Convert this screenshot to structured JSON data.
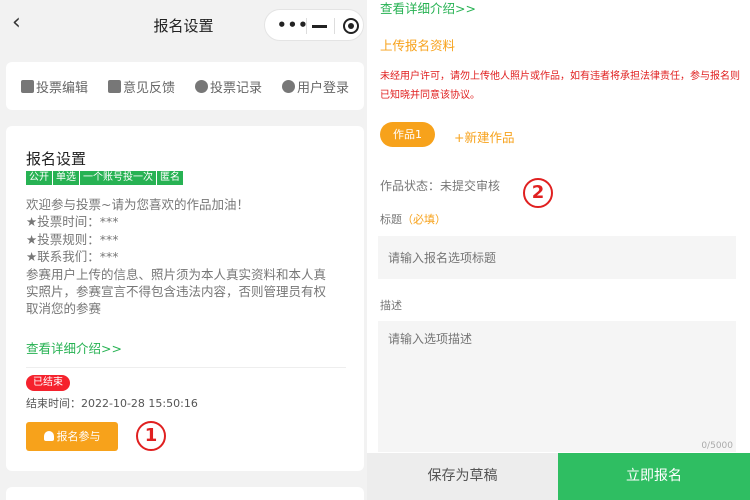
{
  "nav": {
    "back_glyph": "‹",
    "title": "报名设置"
  },
  "tabs": [
    {
      "label": "投票编辑",
      "icon": "pencil-icon"
    },
    {
      "label": "意见反馈",
      "icon": "calendar-icon"
    },
    {
      "label": "投票记录",
      "icon": "user-icon"
    },
    {
      "label": "用户登录",
      "icon": "login-icon"
    }
  ],
  "card": {
    "title": "报名设置",
    "badges": [
      "公开",
      "单选",
      "一个账号投一次",
      "匿名"
    ],
    "desc_lines": [
      "欢迎参与投票~请为您喜欢的作品加油！",
      "★投票时间：***",
      "★投票规则：***",
      "★联系我们：***",
      "参赛用户上传的信息、照片须为本人真实资料和本人真",
      "实照片，参赛宣言不得包含违法内容，否则管理员有权",
      "取消您的参赛"
    ],
    "more_link": "查看详细介绍>>",
    "ended_badge": "已结束",
    "end_time": "结束时间：2022-10-28 15:50:16",
    "join_button": "报名参与"
  },
  "markers": {
    "one": "1",
    "two": "2"
  },
  "form": {
    "more_link": "查看详细介绍>>",
    "upload_title": "上传报名资料",
    "warning": "未经用户许可，请勿上传他人照片或作品，如有违者将承担法律责任，参与报名则已知晓并同意该协议。",
    "work_tab": "作品1",
    "new_work": "+新建作品",
    "status": "作品状态：未提交审核",
    "title_label": "标题",
    "required": "（必填）",
    "title_placeholder": "请输入报名选项标题",
    "desc_label": "描述",
    "desc_placeholder": "请输入选项描述",
    "counter": "0/5000",
    "save_draft": "保存为草稿",
    "submit": "立即报名"
  },
  "colors": {
    "accent_green": "#27b253",
    "accent_orange": "#f7a21b",
    "alert_red": "#e02020"
  }
}
